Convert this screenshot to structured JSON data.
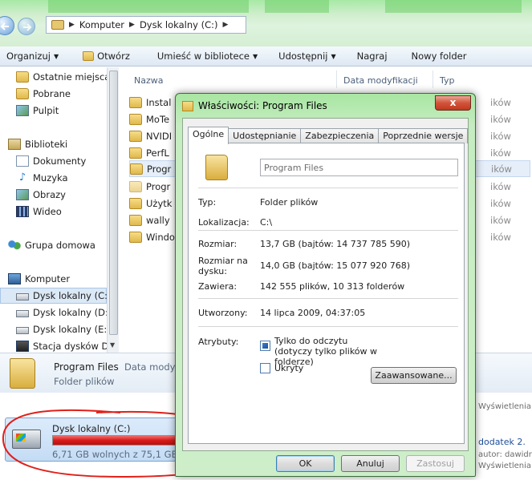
{
  "address_bar": {
    "segments": [
      "Komputer",
      "Dysk lokalny (C:)"
    ]
  },
  "toolbar": {
    "items": [
      {
        "label": "Organizuj",
        "dropdown": true
      },
      {
        "label": "Otwórz",
        "dropdown": false,
        "icon": "folder-icon"
      },
      {
        "label": "Umieść w bibliotece",
        "dropdown": true
      },
      {
        "label": "Udostępnij",
        "dropdown": true
      },
      {
        "label": "Nagraj",
        "dropdown": false
      },
      {
        "label": "Nowy folder",
        "dropdown": false
      }
    ]
  },
  "nav_pane": {
    "favorites": [
      "Ostatnie miejsca",
      "Pobrane",
      "Pulpit"
    ],
    "libraries_title": "Biblioteki",
    "libraries": [
      "Dokumenty",
      "Muzyka",
      "Obrazy",
      "Wideo"
    ],
    "homegroup": "Grupa domowa",
    "computer_title": "Komputer",
    "drives": [
      "Dysk lokalny (C:)",
      "Dysk lokalny (D:)",
      "Dysk lokalny (E:)",
      "Stacja dysków DV"
    ]
  },
  "file_list": {
    "columns": [
      "Nazwa",
      "Data modyfikacji",
      "Typ"
    ],
    "files": [
      "Instal",
      "MoTe",
      "NVIDI",
      "PerfL",
      "Progr",
      "Progr",
      "Użytk",
      "wally",
      "Windo"
    ],
    "type_fragment": "ików"
  },
  "details": {
    "name": "Program Files",
    "modified_fragment": "Data modyfi",
    "type": "Folder plików"
  },
  "drive_tile": {
    "label": "Dysk lokalny (C:)",
    "free": "6,71 GB wolnych z 75,1 GB",
    "used_fraction": 0.91
  },
  "right_snippets": {
    "views1": "Wyświetlenia:",
    "dodatek": "dodatek 2.",
    "autor": "autor: dawidra",
    "views2": "Wyświetlenia:"
  },
  "dialog": {
    "title": "Właściwości: Program Files",
    "close": "x",
    "tabs": [
      "Ogólne",
      "Udostępnianie",
      "Zabezpieczenia",
      "Poprzednie wersje"
    ],
    "name_value": "Program Files",
    "labels": {
      "type": "Typ:",
      "location": "Lokalizacja:",
      "size": "Rozmiar:",
      "size_on_disk": "Rozmiar na dysku:",
      "contains": "Zawiera:",
      "created": "Utworzony:",
      "attributes": "Atrybuty:"
    },
    "values": {
      "type": "Folder plików",
      "location": "C:\\",
      "size": "13,7 GB (bajtów: 14 737 785 590)",
      "size_on_disk": "14,0 GB (bajtów: 15 077 920 768)",
      "contains": "142 555 plików, 10 313 folderów",
      "created": "14 lipca 2009, 04:37:05"
    },
    "attributes": {
      "readonly_label": "Tylko do odczytu (dotyczy tylko plików w folderze)",
      "hidden_label": "Ukryty",
      "advanced_button": "Zaawansowane..."
    },
    "buttons": {
      "ok": "OK",
      "cancel": "Anuluj",
      "apply": "Zastosuj"
    }
  }
}
